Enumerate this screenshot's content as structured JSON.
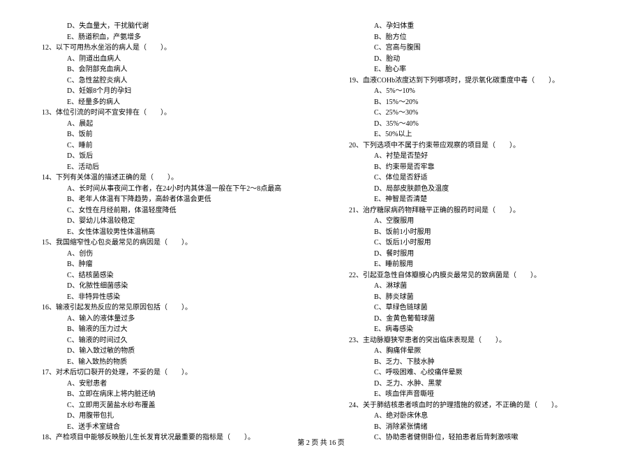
{
  "footer": "第 2 页 共 16 页",
  "left": [
    {
      "cls": "opt",
      "t": "D、失血量大，干扰脑代谢"
    },
    {
      "cls": "opt",
      "t": "E、肠道积血，产氨增多"
    },
    {
      "cls": "q",
      "t": "12、以下可用热水坐浴的病人是（　　）。"
    },
    {
      "cls": "opt",
      "t": "A、阴道出血病人"
    },
    {
      "cls": "opt",
      "t": "B、会阴部充血病人"
    },
    {
      "cls": "opt",
      "t": "C、急性盆腔炎病人"
    },
    {
      "cls": "opt",
      "t": "D、妊娠8个月的孕妇"
    },
    {
      "cls": "opt",
      "t": "E、经量多的病人"
    },
    {
      "cls": "q",
      "t": "13、体位引流的时间不宜安排在（　　）。"
    },
    {
      "cls": "opt",
      "t": "A、晨起"
    },
    {
      "cls": "opt",
      "t": "B、饭前"
    },
    {
      "cls": "opt",
      "t": "C、睡前"
    },
    {
      "cls": "opt",
      "t": "D、饭后"
    },
    {
      "cls": "opt",
      "t": "E、活动后"
    },
    {
      "cls": "q",
      "t": "14、下列有关体温的描述正确的是（　　）。"
    },
    {
      "cls": "opt",
      "t": "A、长时间从事夜间工作者，在24小时内其体温一般在下午2～8点最高"
    },
    {
      "cls": "opt",
      "t": "B、老年人体温有下降趋势，高龄者体温会更低"
    },
    {
      "cls": "opt",
      "t": "C、女性在月经前期，体温轻度降低"
    },
    {
      "cls": "opt",
      "t": "D、婴幼儿体温较稳定"
    },
    {
      "cls": "opt",
      "t": "E、女性体温较男性体温稍高"
    },
    {
      "cls": "q",
      "t": "15、我国缩窄性心包炎最常见的病因是（　　）。"
    },
    {
      "cls": "opt",
      "t": "A、创伤"
    },
    {
      "cls": "opt",
      "t": "B、肿瘤"
    },
    {
      "cls": "opt",
      "t": "C、结核菌感染"
    },
    {
      "cls": "opt",
      "t": "D、化脓性细菌感染"
    },
    {
      "cls": "opt",
      "t": "E、非特异性感染"
    },
    {
      "cls": "q",
      "t": "16、输液引起发热反应的常见原因包括（　　）。"
    },
    {
      "cls": "opt",
      "t": "A、输入的液体量过多"
    },
    {
      "cls": "opt",
      "t": "B、输液的压力过大"
    },
    {
      "cls": "opt",
      "t": "C、输液的时间过久"
    },
    {
      "cls": "opt",
      "t": "D、输入致过敏的物质"
    },
    {
      "cls": "opt",
      "t": "E、输入致热的物质"
    },
    {
      "cls": "q",
      "t": "17、对术后切口裂开的处理，不妥的是（　　）。"
    },
    {
      "cls": "opt",
      "t": "A、安慰患者"
    },
    {
      "cls": "opt",
      "t": "B、立即在病床上将内脏还纳"
    },
    {
      "cls": "opt",
      "t": "C、立即用灭菌盐水纱布覆盖"
    },
    {
      "cls": "opt",
      "t": "D、用腹带包扎"
    },
    {
      "cls": "opt",
      "t": "E、送手术室缝合"
    },
    {
      "cls": "q",
      "t": "18、产检项目中能够反映胎儿生长发育状况最重要的指标是（　　）。"
    }
  ],
  "right": [
    {
      "cls": "opt",
      "t": "A、孕妇体重"
    },
    {
      "cls": "opt",
      "t": "B、胎方位"
    },
    {
      "cls": "opt",
      "t": "C、宫高与腹围"
    },
    {
      "cls": "opt",
      "t": "D、胎动"
    },
    {
      "cls": "opt",
      "t": "E、胎心率"
    },
    {
      "cls": "q",
      "t": "19、血液COHb浓度达到下列哪项时，提示氧化碳重度中毒（　　）。"
    },
    {
      "cls": "opt",
      "t": "A、5%～10%"
    },
    {
      "cls": "opt",
      "t": "B、15%～20%"
    },
    {
      "cls": "opt",
      "t": "C、25%～30%"
    },
    {
      "cls": "opt",
      "t": "D、35%～40%"
    },
    {
      "cls": "opt",
      "t": "E、50%以上"
    },
    {
      "cls": "q",
      "t": "20、下列选项中不属于约束带应观察的项目是（　　）。"
    },
    {
      "cls": "opt",
      "t": "A、衬垫是否垫好"
    },
    {
      "cls": "opt",
      "t": "B、约束带是否牢靠"
    },
    {
      "cls": "opt",
      "t": "C、体位是否舒适"
    },
    {
      "cls": "opt",
      "t": "D、局部皮肤颜色及温度"
    },
    {
      "cls": "opt",
      "t": "E、神智是否清楚"
    },
    {
      "cls": "q",
      "t": "21、治疗糖尿病药物拜糖平正确的服药时间是（　　）。"
    },
    {
      "cls": "opt",
      "t": "A、空腹服用"
    },
    {
      "cls": "opt",
      "t": "B、饭前1小时服用"
    },
    {
      "cls": "opt",
      "t": "C、饭后1小时服用"
    },
    {
      "cls": "opt",
      "t": "D、餐时服用"
    },
    {
      "cls": "opt",
      "t": "E、睡前服用"
    },
    {
      "cls": "q",
      "t": "22、引起亚急性自体瓣膜心内膜炎最常见的致病菌是（　　）。"
    },
    {
      "cls": "opt",
      "t": "A、淋球菌"
    },
    {
      "cls": "opt",
      "t": "B、肺炎球菌"
    },
    {
      "cls": "opt",
      "t": "C、草绿色链球菌"
    },
    {
      "cls": "opt",
      "t": "D、金黄色葡萄球菌"
    },
    {
      "cls": "opt",
      "t": "E、病毒感染"
    },
    {
      "cls": "q",
      "t": "23、主动脉瓣狭窄患者的突出临床表现是（　　）。"
    },
    {
      "cls": "opt",
      "t": "A、胸痛伴晕厥"
    },
    {
      "cls": "opt",
      "t": "B、乏力、下肢水肿"
    },
    {
      "cls": "opt",
      "t": "C、呼吸困难、心绞痛伴晕厥"
    },
    {
      "cls": "opt",
      "t": "D、乏力、水肿、黑蒙"
    },
    {
      "cls": "opt",
      "t": "E、咳血伴声音嘶哑"
    },
    {
      "cls": "q",
      "t": "24、关于肺结核患者咳血时的护理措施的叙述，不正确的是（　　）。"
    },
    {
      "cls": "opt",
      "t": "A、绝对卧床休息"
    },
    {
      "cls": "opt",
      "t": "B、消除紧张情绪"
    },
    {
      "cls": "opt",
      "t": "C、协助患者健侧卧位，轻拍患者后背刺激咳嗽"
    }
  ]
}
